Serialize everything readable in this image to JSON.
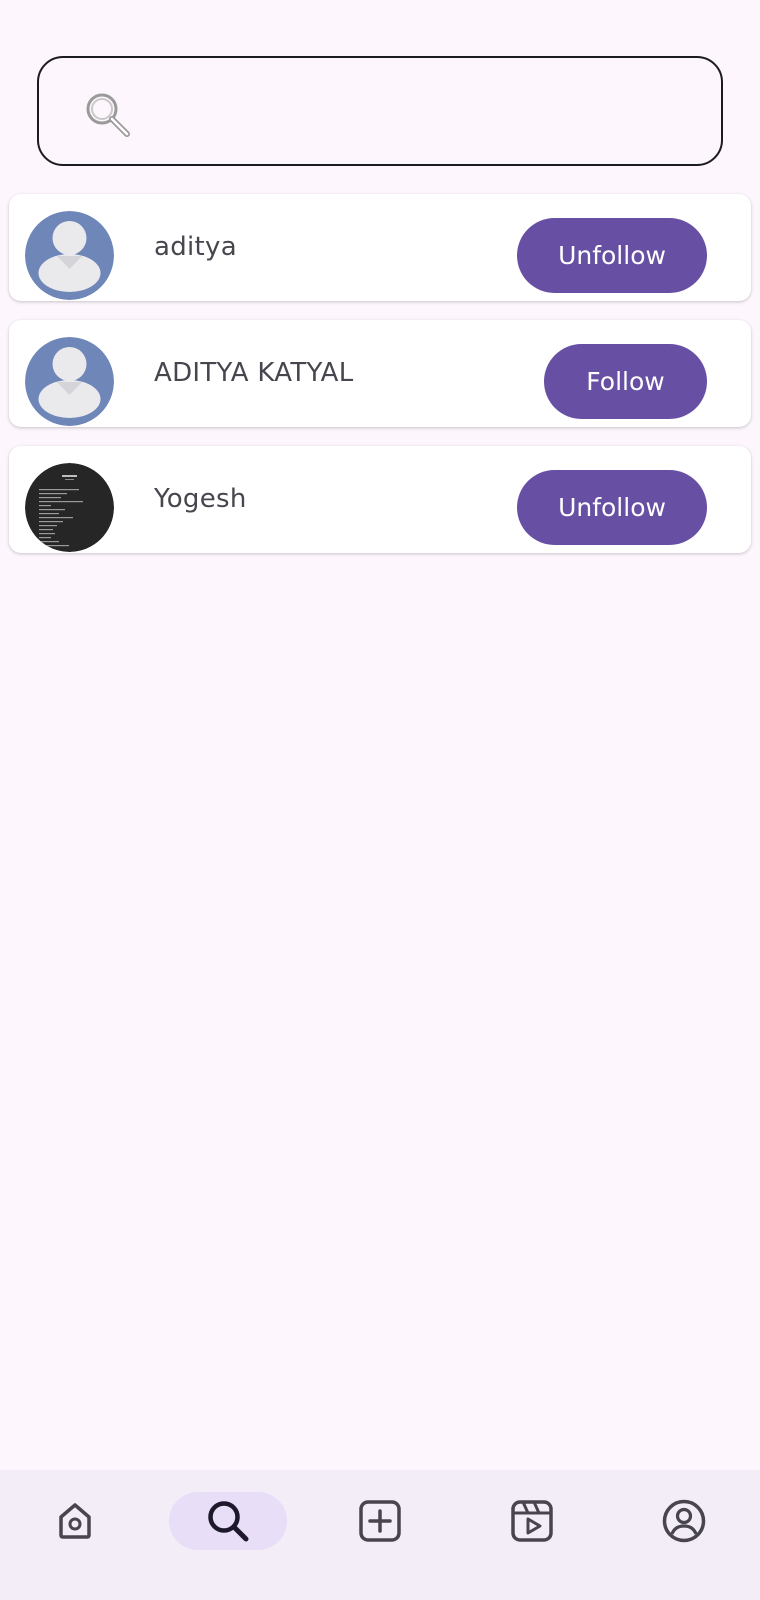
{
  "search": {
    "placeholder": "",
    "value": "",
    "icon": "search-icon"
  },
  "users": [
    {
      "name": "aditya",
      "button_label": "Unfollow",
      "avatar": "default-avatar"
    },
    {
      "name": "ADITYA KATYAL",
      "button_label": "Follow",
      "avatar": "default-avatar"
    },
    {
      "name": "Yogesh",
      "button_label": "Unfollow",
      "avatar": "photo-avatar"
    }
  ],
  "bottom_nav": {
    "items": [
      {
        "name": "home",
        "icon": "home-icon",
        "active": false
      },
      {
        "name": "search",
        "icon": "search-icon",
        "active": true
      },
      {
        "name": "add-post",
        "icon": "add-box-icon",
        "active": false
      },
      {
        "name": "reels",
        "icon": "reels-icon",
        "active": false
      },
      {
        "name": "profile",
        "icon": "account-circle-icon",
        "active": false
      }
    ]
  },
  "colors": {
    "background": "#fdf7fd",
    "accent": "#6750a4",
    "nav_background": "#f2edf7",
    "nav_active": "#e8def8",
    "avatar_default": "#6f86b8"
  }
}
